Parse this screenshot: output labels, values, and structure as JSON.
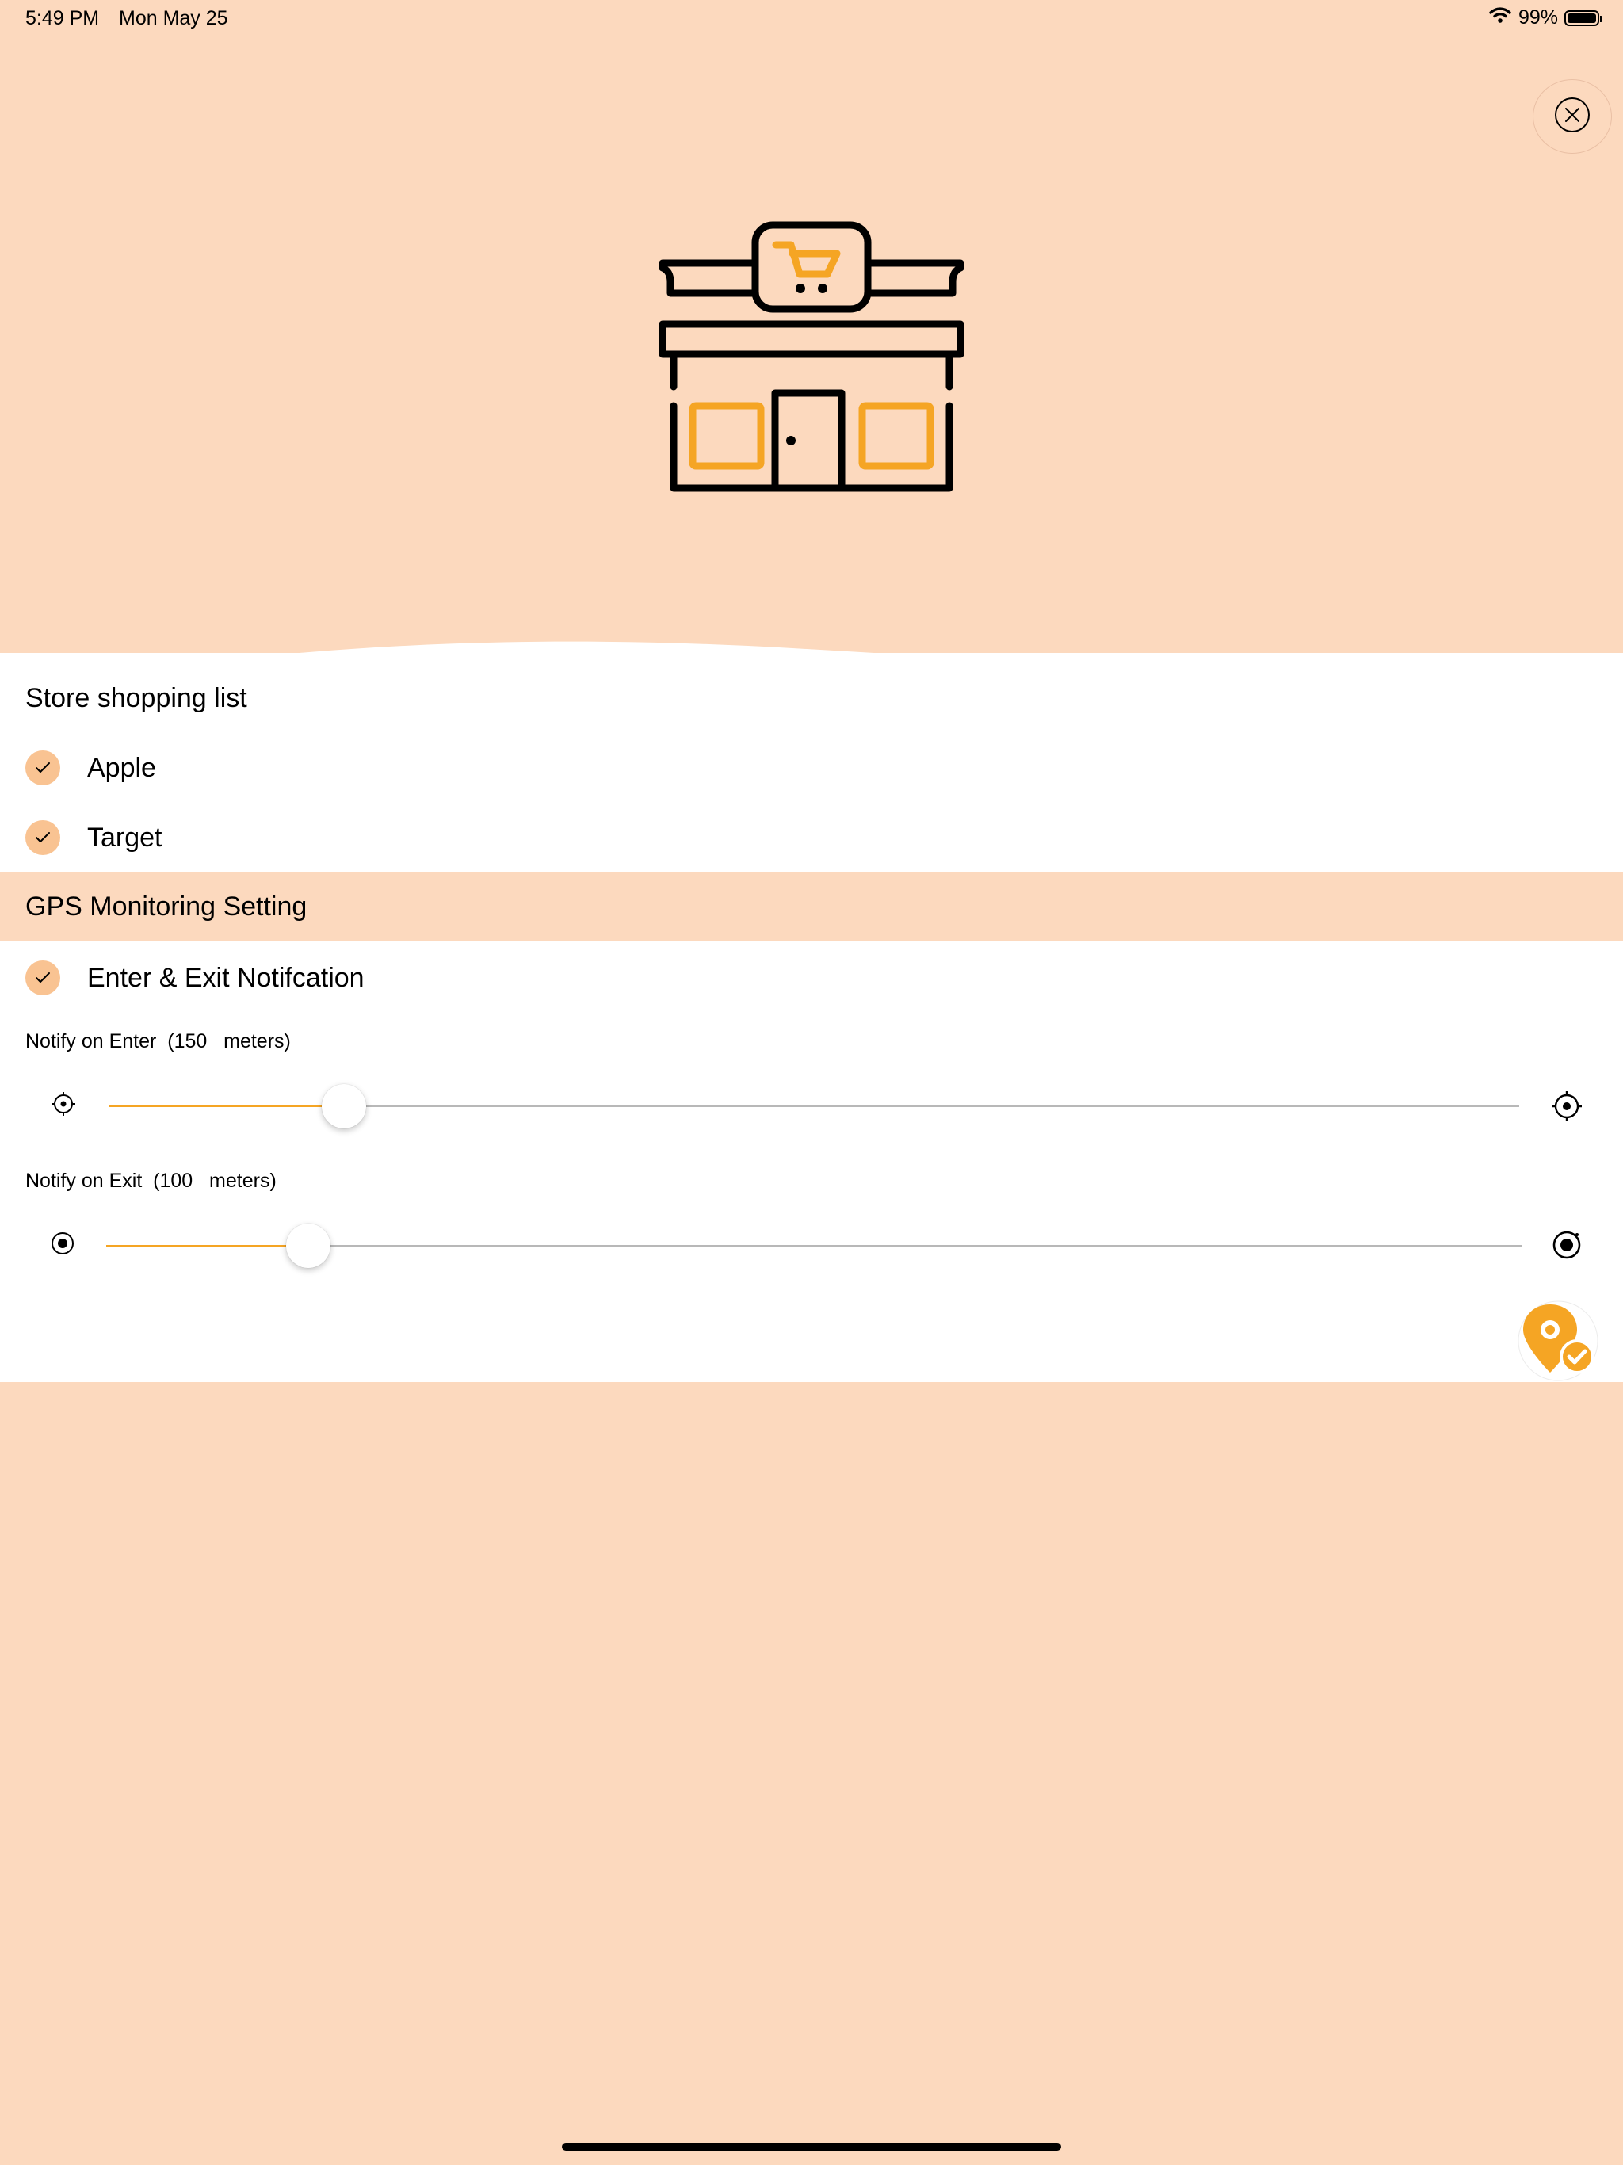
{
  "status_bar": {
    "time": "5:49 PM",
    "date": "Mon May 25",
    "battery_text": "99%",
    "battery_level": 0.99
  },
  "header": {
    "icon": "store-cart-icon",
    "close_icon": "close-circle-icon"
  },
  "shopping_list": {
    "title": "Store shopping list",
    "items": [
      {
        "label": "Apple",
        "checked": true
      },
      {
        "label": "Target",
        "checked": true
      }
    ]
  },
  "gps_settings": {
    "title": "GPS Monitoring Setting",
    "notification_toggle": {
      "label": "Enter & Exit Notifcation",
      "checked": true
    },
    "enter_slider": {
      "label": "Notify on Enter  (150   meters)",
      "value_fraction": 0.167
    },
    "exit_slider": {
      "label": "Notify on Exit  (100   meters)",
      "value_fraction": 0.143
    },
    "save_icon": "location-check-icon"
  },
  "colors": {
    "accent": "#F5A524",
    "background": "#FCD9BE",
    "check_circle": "#F9C392"
  }
}
